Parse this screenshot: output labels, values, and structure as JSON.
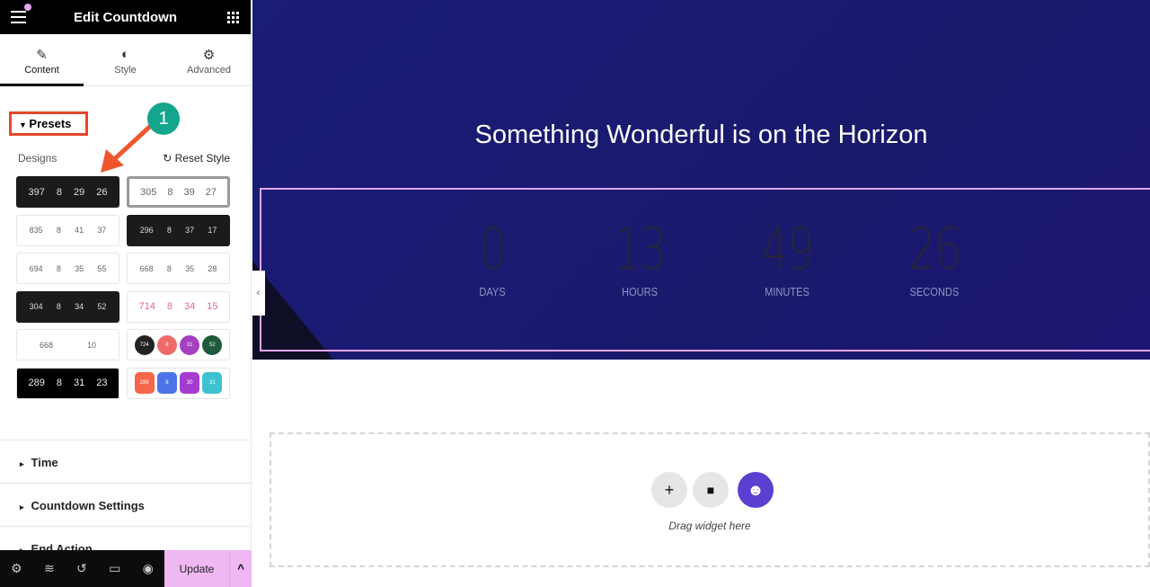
{
  "header": {
    "title": "Edit Countdown"
  },
  "tabs": [
    {
      "label": "Content",
      "icon": "pencil-icon"
    },
    {
      "label": "Style",
      "icon": "contrast-icon"
    },
    {
      "label": "Advanced",
      "icon": "gear-icon"
    }
  ],
  "presets": {
    "title": "Presets",
    "designs_label": "Designs",
    "reset_label": "Reset Style",
    "badge": "1",
    "thumbs": [
      [
        "397",
        "8",
        "29",
        "26"
      ],
      [
        "305",
        "8",
        "39",
        "27"
      ],
      [
        "835",
        "8",
        "41",
        "37"
      ],
      [
        "296",
        "8",
        "37",
        "17"
      ],
      [
        "694",
        "8",
        "35",
        "55"
      ],
      [
        "668",
        "8",
        "35",
        "28"
      ],
      [
        "304",
        "8",
        "34",
        "52"
      ],
      [
        "714",
        "8",
        "34",
        "15"
      ],
      [
        "668",
        "10"
      ],
      [
        "724",
        "8",
        "31",
        "52"
      ],
      [
        "289",
        "8",
        "31",
        "23"
      ],
      [
        "288",
        "8",
        "30",
        "31"
      ]
    ]
  },
  "sections": [
    "Time",
    "Countdown Settings",
    "End Action"
  ],
  "footer": {
    "update": "Update"
  },
  "canvas": {
    "title": "Something Wonderful is on the Horizon",
    "countdown": [
      {
        "value": "0",
        "label": "DAYS"
      },
      {
        "value": "13",
        "label": "HOURS"
      },
      {
        "value": "49",
        "label": "MINUTES"
      },
      {
        "value": "26",
        "label": "SECONDS"
      }
    ],
    "drag_text": "Drag widget here"
  },
  "colors": {
    "accent": "#efb8f3",
    "hero_bg": "#1b1b78",
    "highlight": "#e8462a",
    "badge": "#14a58d"
  }
}
